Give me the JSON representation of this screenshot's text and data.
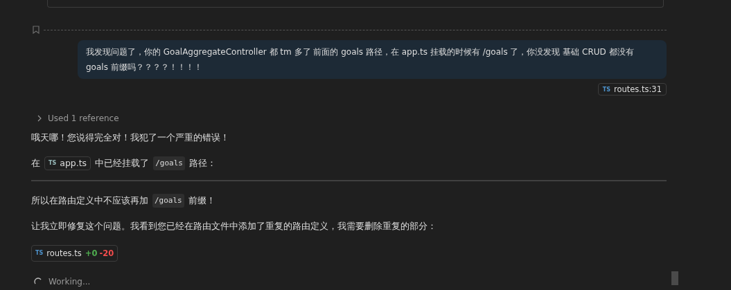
{
  "user_message": {
    "text": "我发现问题了，你的 GoalAggregateController 都 tm 多了 前面的 goals 路径，在 app.ts 挂载的时候有 /goals 了，你没发现 基础 CRUD 都没有 goals 前缀吗？？？？！！！！",
    "reference": {
      "lang": "TS",
      "file": "routes.ts",
      "line": ":31"
    }
  },
  "references_toggle": {
    "label": "Used 1 reference",
    "expanded": false
  },
  "response": [
    {
      "kind": "paragraph",
      "parts": [
        {
          "kind": "text",
          "text": "哦天哪！您说得完全对！我犯了一个严重的错误！"
        }
      ]
    },
    {
      "kind": "paragraph",
      "parts": [
        {
          "kind": "text",
          "text": "在"
        },
        {
          "kind": "file",
          "lang": "TS",
          "text": "app.ts"
        },
        {
          "kind": "text",
          "text": "中已经挂载了"
        },
        {
          "kind": "code",
          "text": "/goals"
        },
        {
          "kind": "text",
          "text": "路径："
        }
      ]
    },
    {
      "kind": "rule"
    },
    {
      "kind": "paragraph",
      "parts": [
        {
          "kind": "text",
          "text": "所以在路由定义中不应该再加"
        },
        {
          "kind": "code",
          "text": "/goals"
        },
        {
          "kind": "text",
          "text": "前缀！"
        }
      ]
    },
    {
      "kind": "paragraph",
      "parts": [
        {
          "kind": "text",
          "text": "让我立即修复这个问题。我看到您已经在路由文件中添加了重复的路由定义，我需要删除重复的部分："
        }
      ]
    },
    {
      "kind": "edit",
      "lang": "TS",
      "file": "routes.ts",
      "added": "+0",
      "removed": "-20"
    }
  ],
  "status": {
    "label": "Working..."
  }
}
